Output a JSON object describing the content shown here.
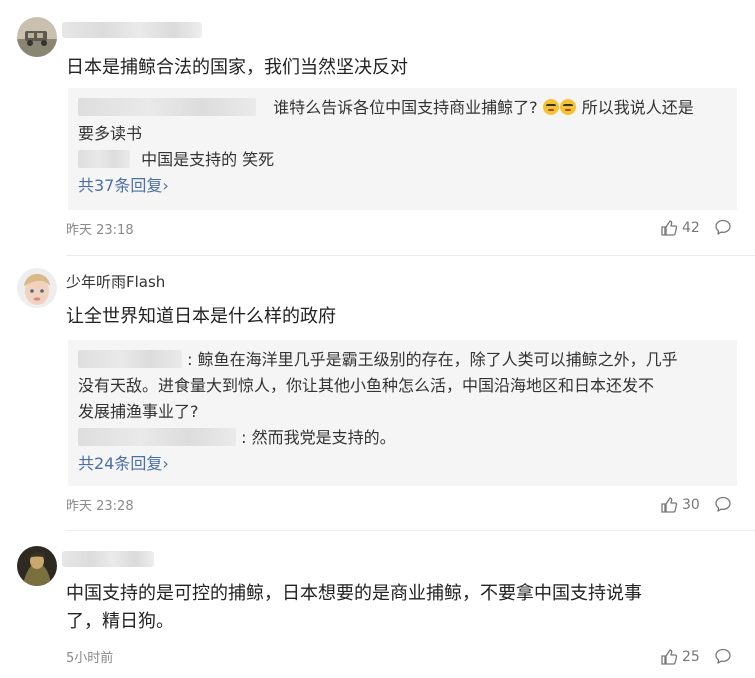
{
  "comments": [
    {
      "username": "",
      "content": "日本是捕鲸合法的国家，我们当然坚决反对",
      "replies": [
        {
          "name": "",
          "text": "谁特么告诉各位中国支持商业捕鲸了?",
          "emoji": "sleepy-face-emoji",
          "text2": "所以我说人还是"
        },
        {
          "name": "",
          "text": "要多读书"
        },
        {
          "name": "",
          "text": "中国是支持的 笑死"
        }
      ],
      "more_replies": "共37条回复",
      "time": "昨天 23:18",
      "likes": "42"
    },
    {
      "username": "少年听雨Flash",
      "content": "让全世界知道日本是什么样的政府",
      "replies": [
        {
          "name": "",
          "text": ": 鲸鱼在海洋里几乎是霸王级别的存在，除了人类可以捕鲸之外，几乎"
        },
        {
          "name": "",
          "text": "没有天敌。进食量大到惊人，你让其他小鱼种怎么活，中国沿海地区和日本还发不"
        },
        {
          "name": "",
          "text": "发展捕渔事业了?"
        },
        {
          "name": "",
          "text": ": 然而我党是支持的。"
        }
      ],
      "more_replies": "共24条回复",
      "time": "昨天 23:28",
      "likes": "30"
    },
    {
      "username": "",
      "content_line1": "中国支持的是可控的捕鲸，日本想要的是商业捕鲸，不要拿中国支持说事",
      "content_line2": "了，精日狗。",
      "time": "5小时前",
      "likes": "25"
    }
  ],
  "icons": {
    "like": "thumbs-up-icon",
    "more": "comment-bubble-icon"
  },
  "colors": {
    "link": "#4a6fa5",
    "reply_bg": "#f5f5f5",
    "meta": "#8a8a8a"
  }
}
